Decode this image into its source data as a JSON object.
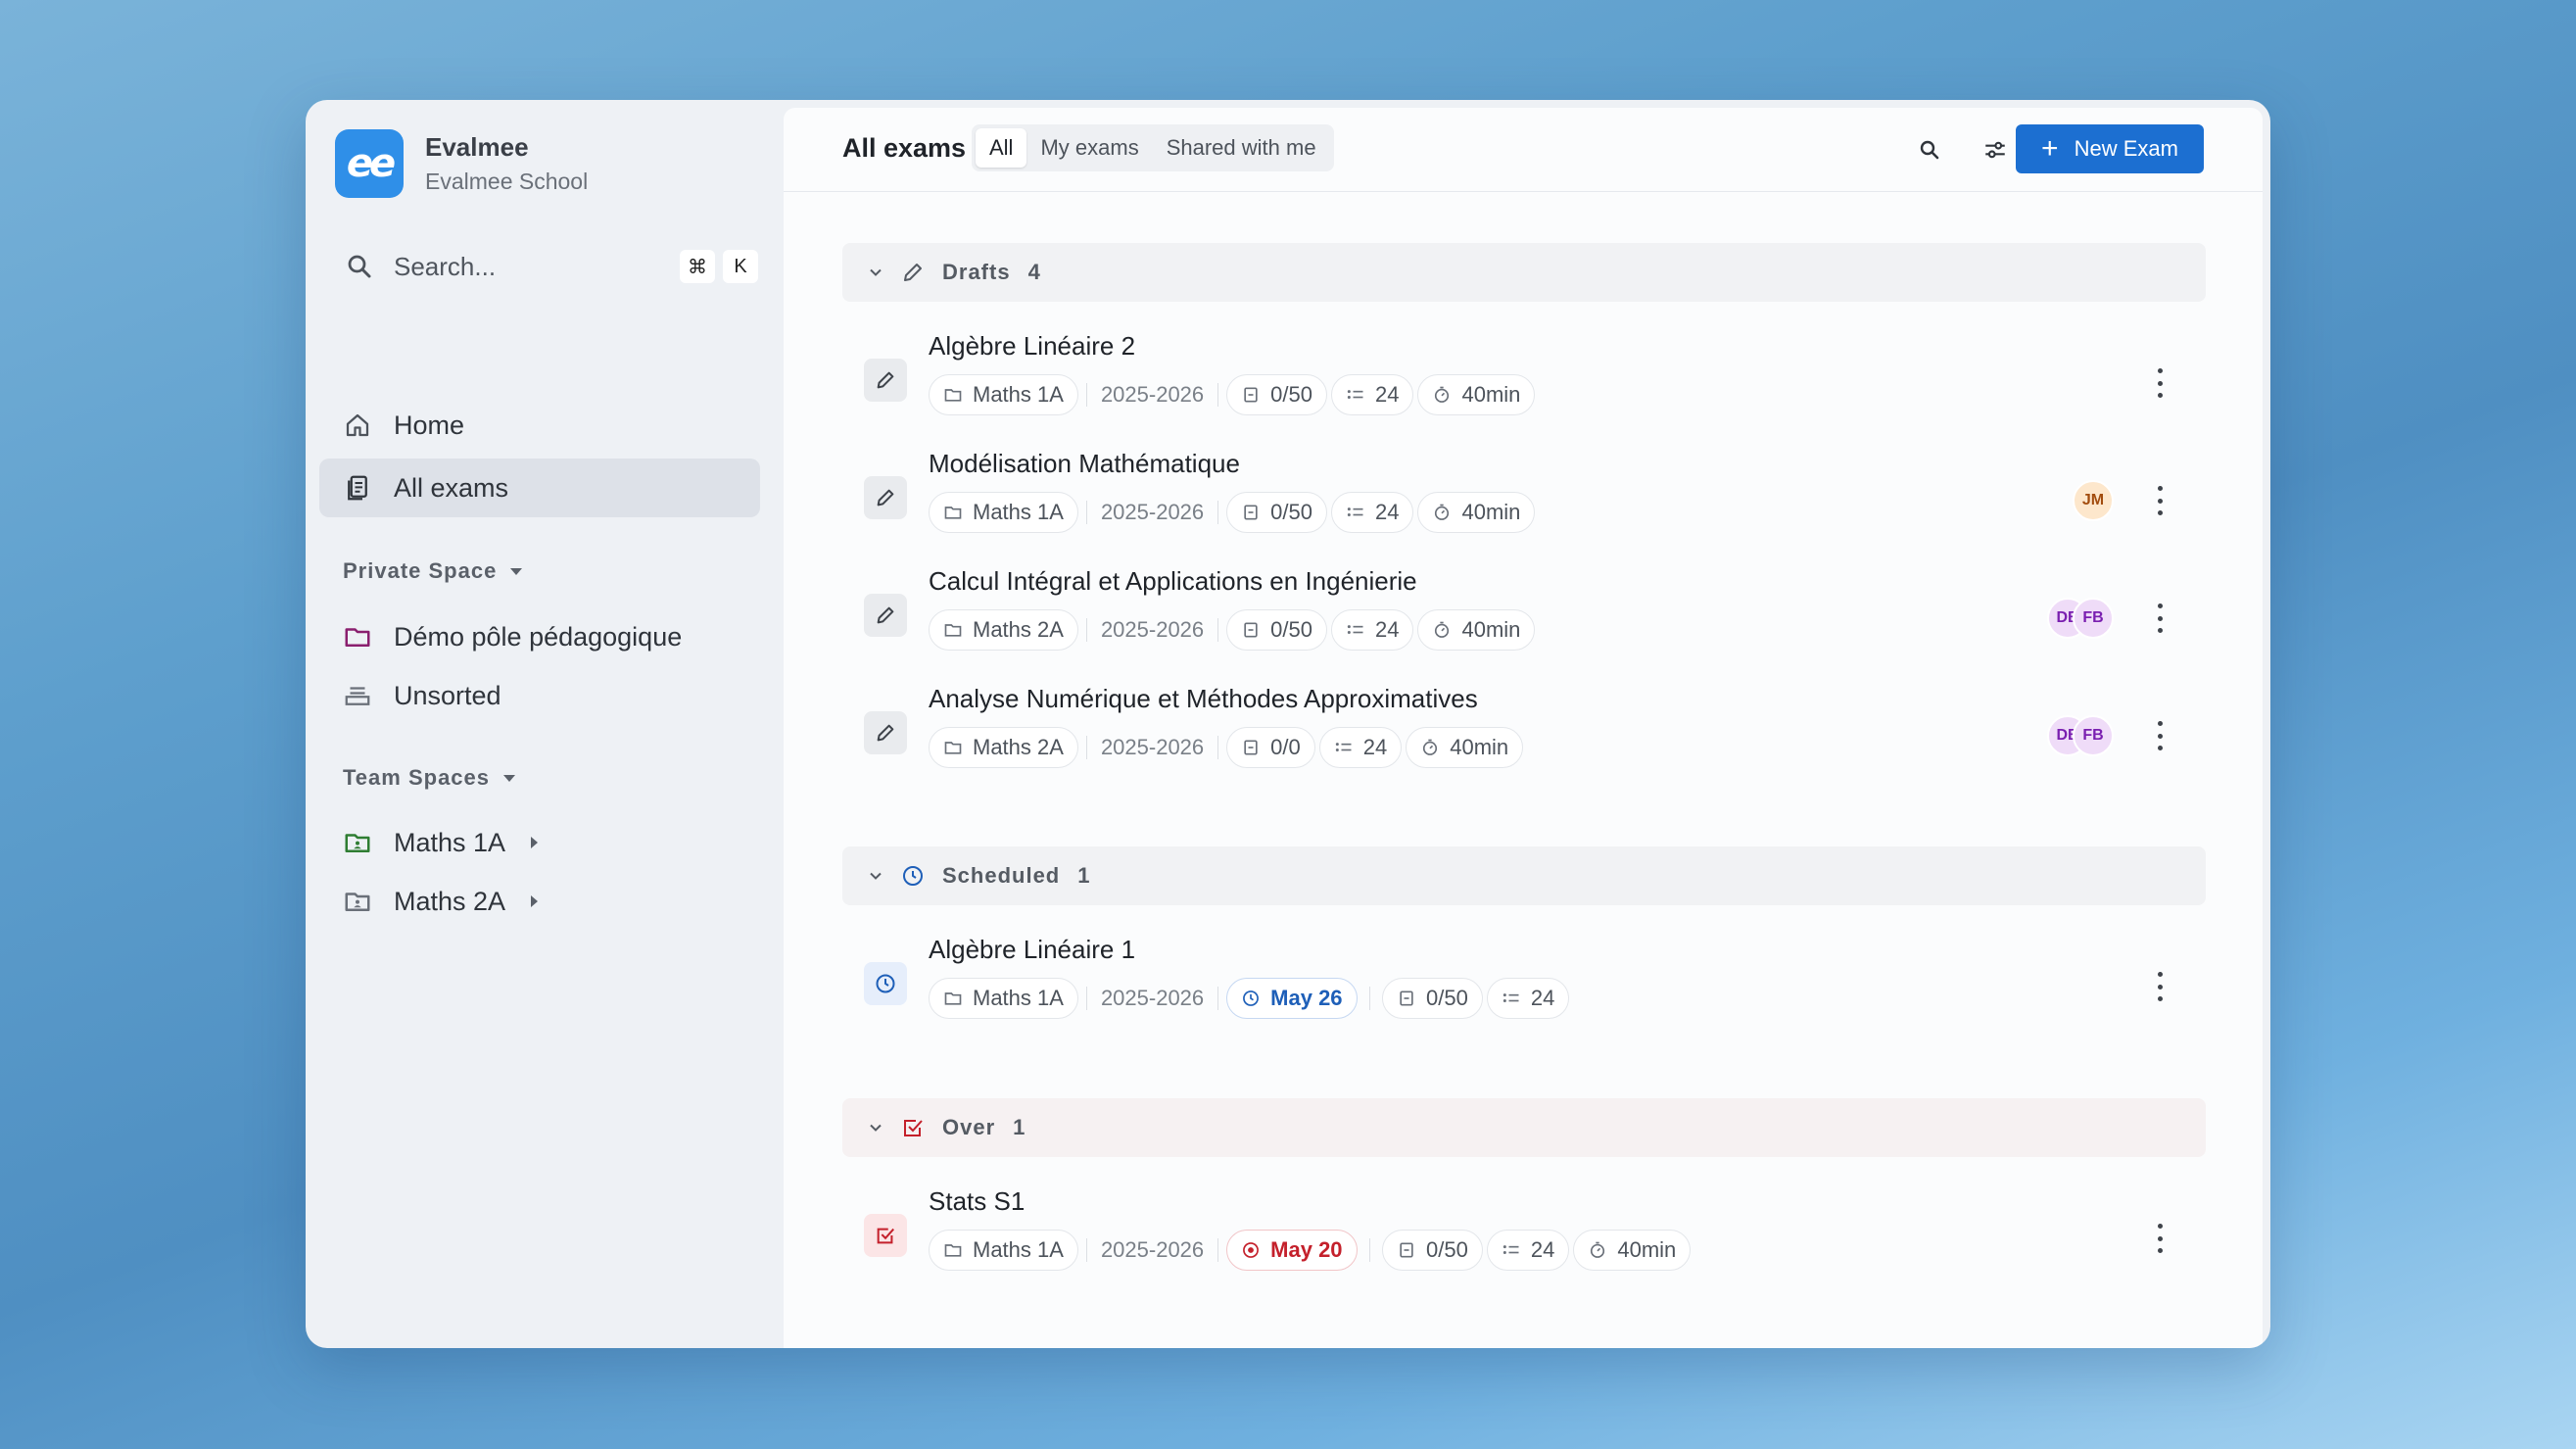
{
  "brand": {
    "logo_text": "ee",
    "name": "Evalmee",
    "subtitle": "Evalmee School"
  },
  "search": {
    "placeholder": "Search...",
    "shortcut_mod": "⌘",
    "shortcut_key": "K"
  },
  "nav": {
    "home": "Home",
    "all_exams": "All exams"
  },
  "private_space": {
    "heading": "Private Space",
    "items": [
      "Démo pôle pédagogique",
      "Unsorted"
    ]
  },
  "team_spaces": {
    "heading": "Team Spaces",
    "items": [
      "Maths 1A",
      "Maths 2A"
    ]
  },
  "topbar": {
    "title": "All exams",
    "tabs": [
      "All",
      "My exams",
      "Shared with me"
    ],
    "active_tab": "All",
    "new_button": "New Exam"
  },
  "groups": {
    "drafts": {
      "name": "Drafts",
      "count": "4"
    },
    "scheduled": {
      "name": "Scheduled",
      "count": "1"
    },
    "over": {
      "name": "Over",
      "count": "1"
    }
  },
  "exams": [
    {
      "title": "Algèbre Linéaire 2",
      "class": "Maths 1A",
      "year": "2025-2026",
      "score": "0/50",
      "questions": "24",
      "duration": "40min",
      "avatars": []
    },
    {
      "title": "Modélisation Mathématique",
      "class": "Maths 1A",
      "year": "2025-2026",
      "score": "0/50",
      "questions": "24",
      "duration": "40min",
      "avatars": [
        "JM"
      ]
    },
    {
      "title": "Calcul Intégral et Applications en Ingénierie",
      "class": "Maths 2A",
      "year": "2025-2026",
      "score": "0/50",
      "questions": "24",
      "duration": "40min",
      "avatars": [
        "DB",
        "FB"
      ]
    },
    {
      "title": "Analyse Numérique et Méthodes Approximatives",
      "class": "Maths 2A",
      "year": "2025-2026",
      "score": "0/0",
      "questions": "24",
      "duration": "40min",
      "avatars": [
        "DB",
        "FB"
      ]
    },
    {
      "title": "Algèbre Linéaire 1",
      "class": "Maths 1A",
      "year": "2025-2026",
      "date": "May 26",
      "score": "0/50",
      "questions": "24"
    },
    {
      "title": "Stats S1",
      "class": "Maths 1A",
      "year": "2025-2026",
      "date": "May 20",
      "score": "0/50",
      "questions": "24",
      "duration": "40min"
    }
  ],
  "colors": {
    "primary": "#1c6fd1",
    "logo": "#2f8fe8",
    "scheduled": "#1e5fb8",
    "over": "#c4202b",
    "folder_private": "#8a1f6e",
    "folder_team_1a": "#2e7d32"
  }
}
